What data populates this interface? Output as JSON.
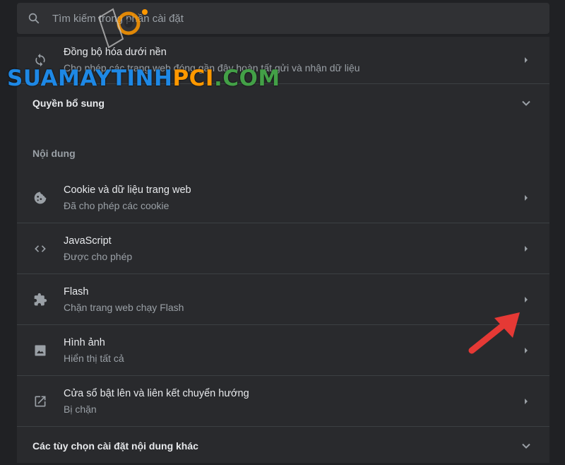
{
  "search": {
    "placeholder": "Tìm kiếm trong phần cài đặt"
  },
  "sync": {
    "title": "Đồng bộ hóa dưới nền",
    "subtitle": "Cho phép các trang web đóng gần đây hoàn tất gửi và nhận dữ liệu"
  },
  "additional_permissions": {
    "title": "Quyền bổ sung"
  },
  "content_section": {
    "label": "Nội dung",
    "items": [
      {
        "title": "Cookie và dữ liệu trang web",
        "subtitle": "Đã cho phép các cookie",
        "icon": "cookie-icon"
      },
      {
        "title": "JavaScript",
        "subtitle": "Được cho phép",
        "icon": "code-icon"
      },
      {
        "title": "Flash",
        "subtitle": "Chặn trang web chạy Flash",
        "icon": "puzzle-icon"
      },
      {
        "title": "Hình ảnh",
        "subtitle": "Hiển thị tất cả",
        "icon": "image-icon"
      },
      {
        "title": "Cửa sổ bật lên và liên kết chuyển hướng",
        "subtitle": "Bị chặn",
        "icon": "open-in-new-icon"
      }
    ]
  },
  "more_content_settings": {
    "title": "Các tùy chọn cài đặt nội dung khác"
  },
  "watermark": {
    "part1": "SUAMAYTINH",
    "part2": "PCI",
    "part3": ".COM"
  },
  "colors": {
    "background": "#202124",
    "card": "#292a2d",
    "text": "#e8eaed",
    "subtext": "#9aa0a6",
    "arrow": "#e53935"
  }
}
